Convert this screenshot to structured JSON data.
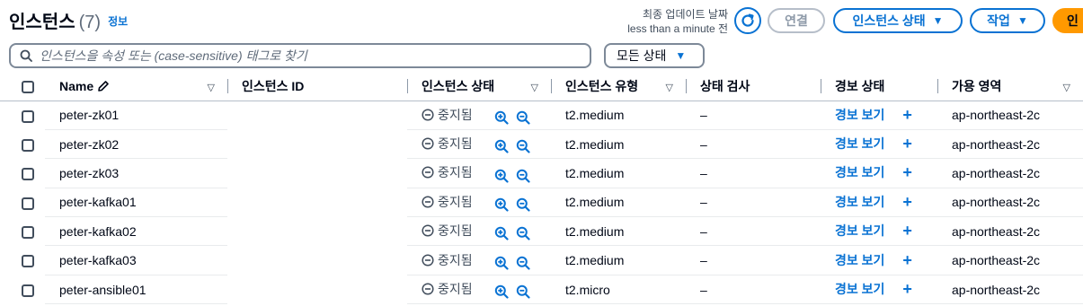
{
  "header": {
    "title": "인스턴스",
    "count": "(7)",
    "info": "정보",
    "last_updated_line1": "최종 업데이트 날짜",
    "last_updated_line2": "less than a minute 전",
    "connect": "연결",
    "instance_state": "인스턴스 상태",
    "actions": "작업",
    "launch": "인"
  },
  "search": {
    "placeholder": "인스턴스을 속성 또는 (case-sensitive) 태그로 찾기"
  },
  "state_filter": {
    "value": "모든 상태"
  },
  "columns": [
    "Name",
    "인스턴스 ID",
    "인스턴스 상태",
    "인스턴스 유형",
    "상태 검사",
    "경보 상태",
    "가용 영역"
  ],
  "rows": [
    {
      "name": "peter-zk01",
      "id": "",
      "state": "중지됨",
      "type": "t2.medium",
      "check": "–",
      "alarm": "경보 보기",
      "az": "ap-northeast-2c"
    },
    {
      "name": "peter-zk02",
      "id": "",
      "state": "중지됨",
      "type": "t2.medium",
      "check": "–",
      "alarm": "경보 보기",
      "az": "ap-northeast-2c"
    },
    {
      "name": "peter-zk03",
      "id": "",
      "state": "중지됨",
      "type": "t2.medium",
      "check": "–",
      "alarm": "경보 보기",
      "az": "ap-northeast-2c"
    },
    {
      "name": "peter-kafka01",
      "id": "",
      "state": "중지됨",
      "type": "t2.medium",
      "check": "–",
      "alarm": "경보 보기",
      "az": "ap-northeast-2c"
    },
    {
      "name": "peter-kafka02",
      "id": "",
      "state": "중지됨",
      "type": "t2.medium",
      "check": "–",
      "alarm": "경보 보기",
      "az": "ap-northeast-2c"
    },
    {
      "name": "peter-kafka03",
      "id": "",
      "state": "중지됨",
      "type": "t2.medium",
      "check": "–",
      "alarm": "경보 보기",
      "az": "ap-northeast-2c"
    },
    {
      "name": "peter-ansible01",
      "id": "",
      "state": "중지됨",
      "type": "t2.micro",
      "check": "–",
      "alarm": "경보 보기",
      "az": "ap-northeast-2c"
    }
  ],
  "colors": {
    "accent": "#0972d3",
    "primary": "#ff9900",
    "text": "#000716"
  },
  "icons": [
    "search-icon",
    "refresh-icon",
    "pencil-icon",
    "stopped-icon",
    "zoom-in-icon",
    "zoom-out-icon",
    "plus-icon"
  ]
}
